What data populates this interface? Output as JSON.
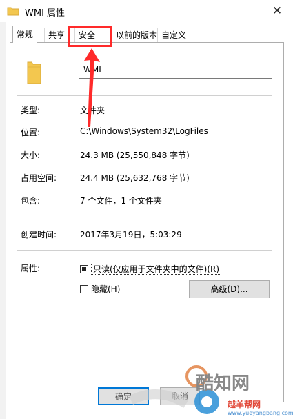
{
  "window": {
    "title": "WMI 属性",
    "close_glyph": "✕"
  },
  "tabs": [
    {
      "label": "常规",
      "active": true
    },
    {
      "label": "共享",
      "active": false
    },
    {
      "label": "安全",
      "active": false,
      "highlighted": true
    },
    {
      "label": "以前的版本",
      "active": false
    },
    {
      "label": "自定义",
      "active": false
    }
  ],
  "general": {
    "folder_name": "WMI",
    "type_label": "类型:",
    "type_value": "文件夹",
    "location_label": "位置:",
    "location_value": "C:\\Windows\\System32\\LogFiles",
    "size_label": "大小:",
    "size_value": "24.3 MB (25,550,848 字节)",
    "size_on_disk_label": "占用空间:",
    "size_on_disk_value": "24.4 MB (25,632,768 字节)",
    "contains_label": "包含:",
    "contains_value": "7 个文件，1 个文件夹",
    "created_label": "创建时间:",
    "created_value": "2017年3月19日，5:03:29",
    "attributes_label": "属性:",
    "readonly_label": "只读(仅应用于文件夹中的文件)(R)",
    "hidden_label": "隐藏(H)",
    "advanced_label": "高级(D)..."
  },
  "buttons": {
    "ok_label": "确定",
    "cancel_label": "取消"
  },
  "watermark": {
    "logo_text": "酷知网",
    "site_title": "越羊帮网",
    "site_url": "www.yueyangbang.com"
  },
  "colors": {
    "highlight": "#ff2a2a",
    "folder": "#f3c74f",
    "accent": "#0078d7"
  },
  "icons": [
    "folder-icon",
    "close-icon",
    "arrow-up-icon"
  ]
}
